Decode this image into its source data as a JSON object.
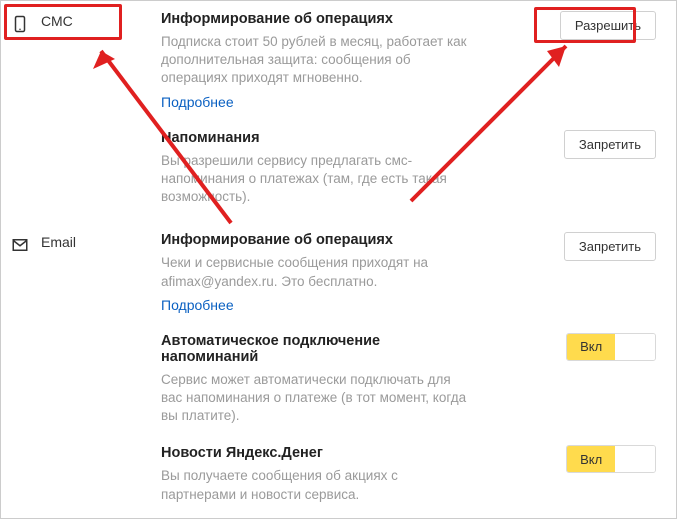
{
  "channels": {
    "sms": {
      "label": "СМС"
    },
    "email": {
      "label": "Email"
    }
  },
  "sms_inform": {
    "title": "Информирование об операциях",
    "desc": "Подписка стоит 50 рублей в месяц, работает как дополнительная защита: сообщения об операциях приходят мгновенно.",
    "more": "Подробнее",
    "button": "Разрешить"
  },
  "sms_remind": {
    "title": "Напоминания",
    "desc": "Вы разрешили сервису предлагать смс-напоминания о платежах (там, где есть такая возможность).",
    "button": "Запретить"
  },
  "email_inform": {
    "title": "Информирование об операциях",
    "desc": "Чеки и сервисные сообщения приходят на afimax@yandex.ru. Это бесплатно.",
    "more": "Подробнее",
    "button": "Запретить"
  },
  "email_auto": {
    "title": "Автоматическое подключение напоминаний",
    "desc": "Сервис может автоматически подключать для вас напоминания о платеже (в тот момент, когда вы платите).",
    "toggle": "Вкл"
  },
  "email_news": {
    "title": "Новости Яндекс.Денег",
    "desc": "Вы получаете сообщения об акциях с партнерами и новости сервиса.",
    "toggle": "Вкл"
  }
}
